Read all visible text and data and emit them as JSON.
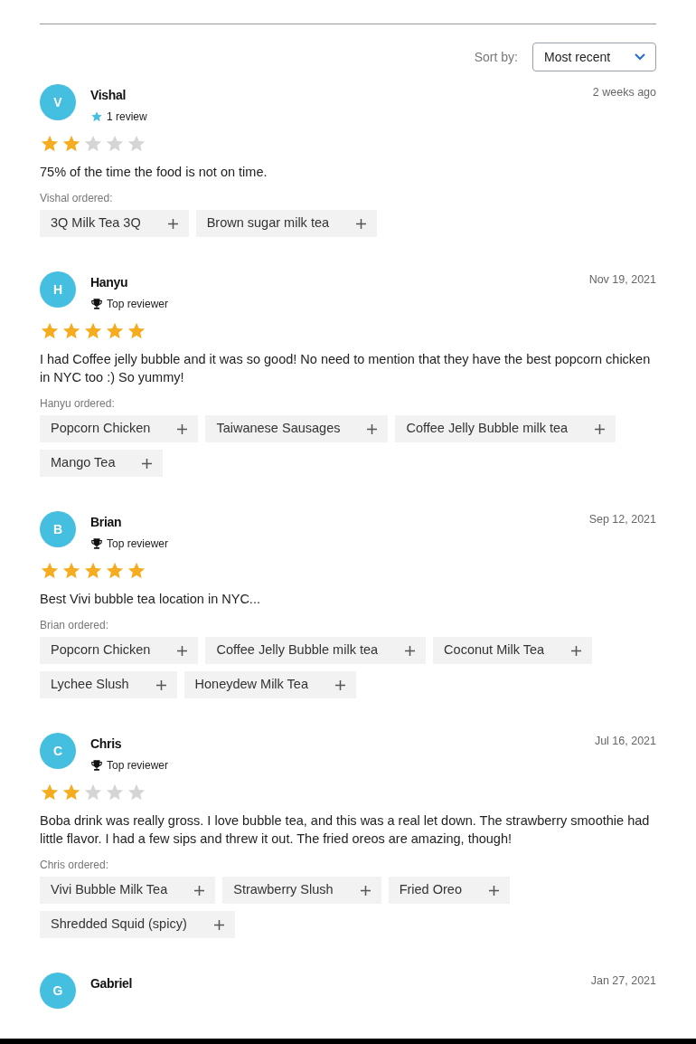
{
  "sort": {
    "label": "Sort by:",
    "value": "Most recent"
  },
  "reviews": [
    {
      "initial": "V",
      "name": "Vishal",
      "badge": {
        "kind": "count",
        "text": "1 review"
      },
      "date": "2 weeks ago",
      "stars": 2,
      "text": "75% of the time the food is not on time.",
      "ordered_label": "Vishal ordered:",
      "items": [
        "3Q Milk Tea 3Q",
        "Brown sugar milk tea"
      ]
    },
    {
      "initial": "H",
      "name": "Hanyu",
      "badge": {
        "kind": "top",
        "text": "Top reviewer"
      },
      "date": "Nov 19, 2021",
      "stars": 5,
      "text": "I had Coffee jelly bubble and it was so good! No need to mention that they have the best popcorn chicken in NYC too :) So yummy!",
      "ordered_label": "Hanyu ordered:",
      "items": [
        "Popcorn Chicken",
        "Taiwanese Sausages",
        "Coffee Jelly Bubble milk tea",
        "Mango Tea"
      ]
    },
    {
      "initial": "B",
      "name": "Brian",
      "badge": {
        "kind": "top",
        "text": "Top reviewer"
      },
      "date": "Sep 12, 2021",
      "stars": 5,
      "text": "Best Vivi bubble tea location in NYC...",
      "ordered_label": "Brian ordered:",
      "items": [
        "Popcorn Chicken",
        "Coffee Jelly Bubble milk tea",
        "Coconut Milk Tea",
        "Lychee Slush",
        "Honeydew Milk Tea"
      ]
    },
    {
      "initial": "C",
      "name": "Chris",
      "badge": {
        "kind": "top",
        "text": "Top reviewer"
      },
      "date": "Jul 16, 2021",
      "stars": 2,
      "text": "Boba drink was really gross. I love bubble tea, and this was a real let down. The strawberry smoothie had little flavor. I had a few sips and threw it out. The fried oreos are amazing, though!",
      "ordered_label": "Chris ordered:",
      "items": [
        "Vivi Bubble Milk Tea",
        "Strawberry Slush",
        "Fried Oreo",
        "Shredded Squid (spicy)"
      ]
    },
    {
      "initial": "G",
      "name": "Gabriel",
      "date": "Jan 27, 2021"
    }
  ]
}
